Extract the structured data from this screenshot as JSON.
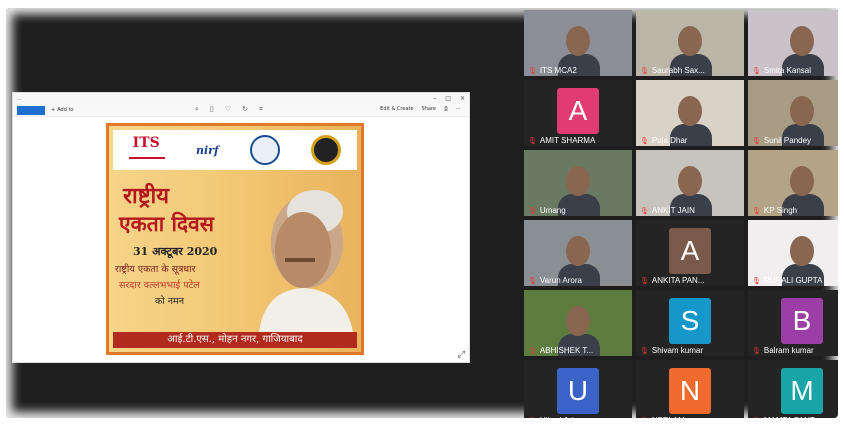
{
  "shared_window": {
    "file_name": "...",
    "toolbar": {
      "add_label": "Add to",
      "edit_label": "Edit & Create",
      "share_label": "Share"
    }
  },
  "poster": {
    "title_line1": "राष्ट्रीय",
    "title_line2": "एकता दिवस",
    "date": "31 अक्टूबर 2020",
    "line1": "राष्ट्रीय एकता के सूत्रधार",
    "line2": "सरदार वल्लभभाई पटेल",
    "line3": "को नमन",
    "footer": "आई.टी.एस., मोहन नगर, गाजियाबाद",
    "its_logo": "ITS",
    "nirf_logo": "nirf"
  },
  "participants": [
    {
      "name": "ITS MCA2",
      "type": "video",
      "bg": "#8c8f97"
    },
    {
      "name": "Saurabh Sax...",
      "type": "video",
      "bg": "#b9b6a8"
    },
    {
      "name": "Smita Kansal",
      "type": "video",
      "bg": "#c9c3c9"
    },
    {
      "name": "AMIT SHARMA",
      "type": "avatar",
      "letter": "A",
      "color": "#e03c73"
    },
    {
      "name": "Puja Dhar",
      "type": "video",
      "bg": "#d9d2c6"
    },
    {
      "name": "Sunil Pandey",
      "type": "video",
      "bg": "#a89c85",
      "active": true
    },
    {
      "name": "Umang",
      "type": "video",
      "bg": "#6a7a62"
    },
    {
      "name": "ANKIT JAIN",
      "type": "video",
      "bg": "#c7c4be"
    },
    {
      "name": "KP Singh",
      "type": "video",
      "bg": "#b4a487"
    },
    {
      "name": "Varun Arora",
      "type": "video",
      "bg": "#8a8f93"
    },
    {
      "name": "ANKITA PAN...",
      "type": "avatar",
      "letter": "A",
      "color": "#7a5a4a"
    },
    {
      "name": "RURALI GUPTA",
      "type": "video",
      "bg": "#f0eeee"
    },
    {
      "name": "ABHISHEK T...",
      "type": "video",
      "bg": "#5d7d3e"
    },
    {
      "name": "Shivam kumar",
      "type": "avatar",
      "letter": "S",
      "color": "#1597c9"
    },
    {
      "name": "Balram kumar",
      "type": "avatar",
      "letter": "B",
      "color": "#9b3ea5"
    },
    {
      "name": "Ujjwal Jain",
      "type": "avatar",
      "letter": "U",
      "color": "#3c63c8"
    },
    {
      "name": "NEELAM",
      "type": "avatar",
      "letter": "N",
      "color": "#f06b2d"
    },
    {
      "name": "MAMTA PANT",
      "type": "avatar",
      "letter": "M",
      "color": "#19a4a8"
    }
  ]
}
